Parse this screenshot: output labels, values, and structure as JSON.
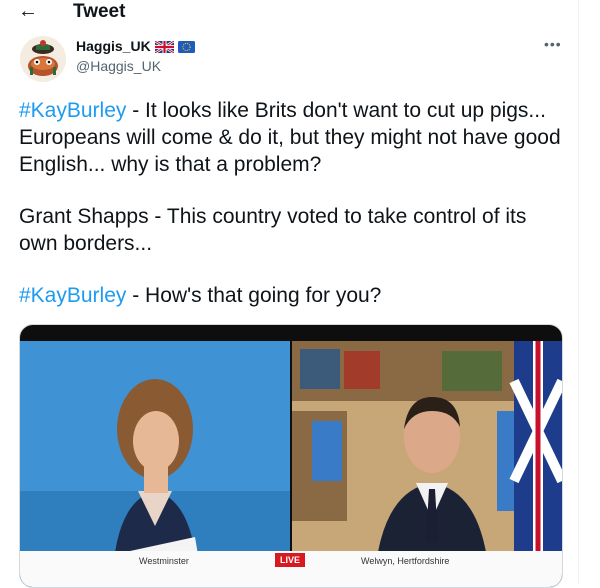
{
  "header": {
    "title": "Tweet",
    "back_icon": "arrow-left-icon"
  },
  "author": {
    "display_name": "Haggis_UK",
    "handle": "@Haggis_UK",
    "badges": [
      "uk-flag-icon",
      "eu-flag-icon"
    ],
    "avatar_icon": "haggis-avatar-icon"
  },
  "tweet": {
    "p1_tag": "#KayBurley",
    "p1_text": " - It looks like Brits don't want to cut up pigs...  Europeans will come & do it, but they might not have good English... why is that a problem?",
    "p2_text": "Grant Shapps - This country voted to take control of its own borders...",
    "p3_tag": "#KayBurley",
    "p3_text": " - How's that going for you?"
  },
  "media": {
    "left_location": "Westminster",
    "live_label": "LIVE",
    "right_location": "Welwyn, Hertfordshire"
  },
  "colors": {
    "link": "#1d9bf0",
    "text": "#0f1419",
    "muted": "#536471",
    "live": "#d71920"
  }
}
